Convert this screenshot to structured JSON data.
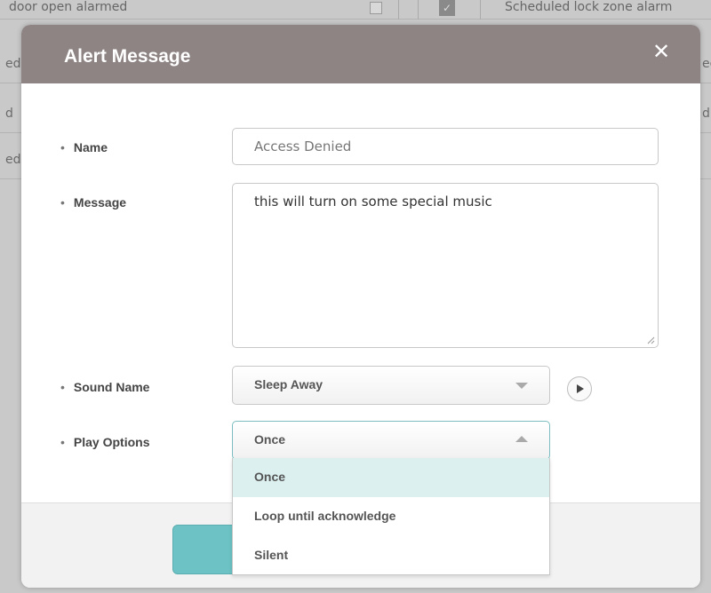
{
  "background": {
    "row0_left_text": "door open alarmed",
    "row0_right_text": "Scheduled lock zone alarm",
    "rows": [
      {
        "left": "ed",
        "right": "ec"
      },
      {
        "left": "d",
        "right": "d"
      },
      {
        "left": "ed",
        "right": ""
      }
    ]
  },
  "dialog": {
    "title": "Alert Message",
    "close_icon": "close-icon",
    "fields": {
      "name_label": "Name",
      "name_value": "Access Denied",
      "message_label": "Message",
      "message_value": "this will turn on some special music",
      "sound_label": "Sound Name",
      "sound_value": "Sleep Away",
      "play_label": "Play Options",
      "play_value": "Once"
    },
    "play_options": [
      "Once",
      "Loop until acknowledge",
      "Silent"
    ],
    "selected_option_index": 0
  },
  "colors": {
    "header": "#8e8484",
    "accent": "#6cc2c4",
    "selected_option_bg": "#ddf0f0"
  }
}
